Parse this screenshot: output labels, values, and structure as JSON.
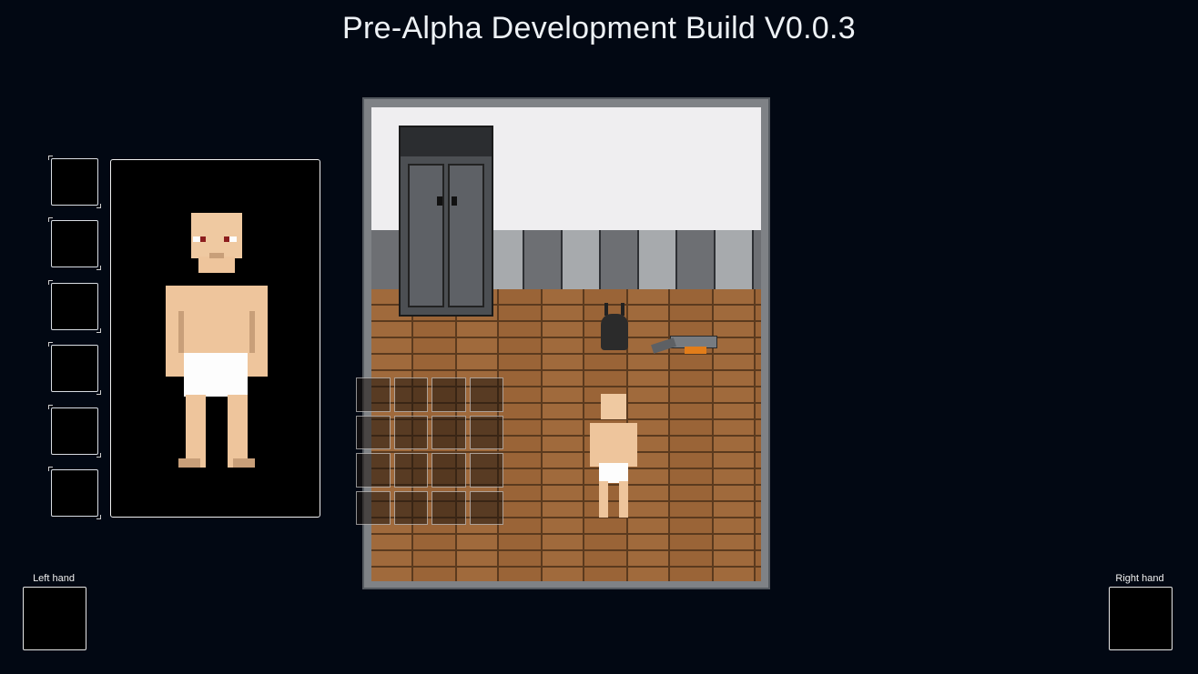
{
  "title": "Pre-Alpha Development Build V0.0.3",
  "equipment": {
    "slot_count": 6
  },
  "hands": {
    "left_label": "Left hand",
    "right_label": "Right hand"
  },
  "colors": {
    "background": "#020813",
    "skin": "#efc9a1",
    "floor": "#a06a3c",
    "wall": "#efeef0"
  },
  "world": {
    "items": [
      "backpack-icon",
      "shotgun-icon"
    ]
  }
}
